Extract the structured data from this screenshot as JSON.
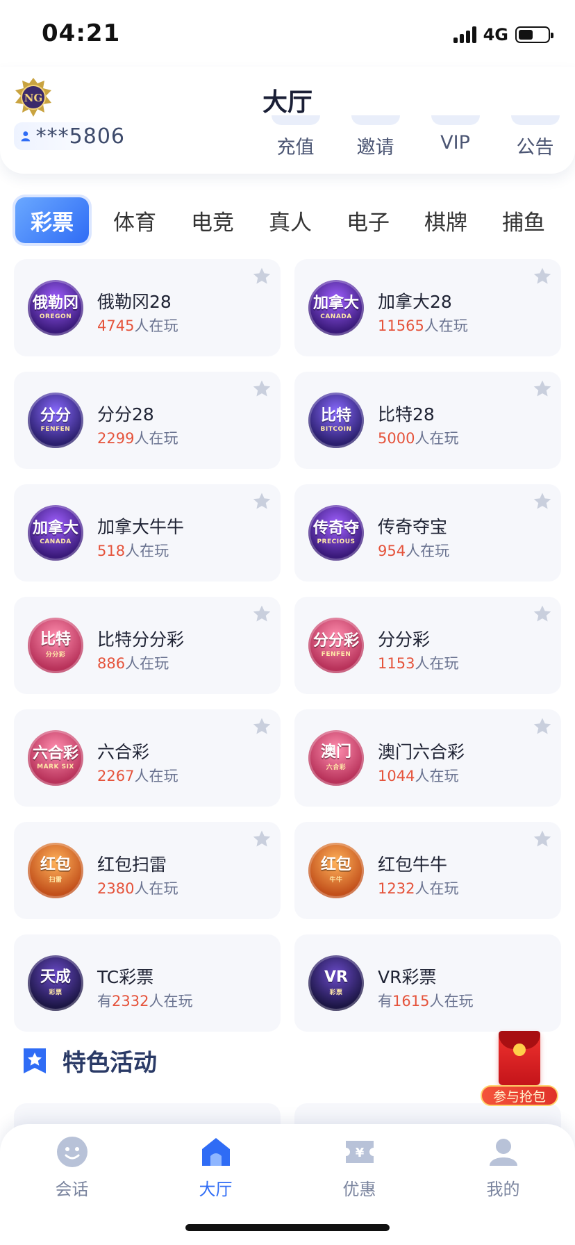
{
  "status": {
    "time": "04:21",
    "network": "4G"
  },
  "header": {
    "title": "大厅",
    "user_id": "***5806",
    "quick_menu": [
      "充值",
      "邀请",
      "VIP",
      "公告"
    ]
  },
  "tabs": [
    "彩票",
    "体育",
    "电竞",
    "真人",
    "电子",
    "棋牌",
    "捕鱼"
  ],
  "games": [
    {
      "name": "俄勒冈28",
      "prefix": "",
      "count": "4745",
      "suffix": "人在玩",
      "icon_text": "俄勒冈",
      "icon_sub": "OREGON"
    },
    {
      "name": "加拿大28",
      "prefix": "",
      "count": "11565",
      "suffix": "人在玩",
      "icon_text": "加拿大",
      "icon_sub": "CANADA"
    },
    {
      "name": "分分28",
      "prefix": "",
      "count": "2299",
      "suffix": "人在玩",
      "icon_text": "分分",
      "icon_sub": "FENFEN"
    },
    {
      "name": "比特28",
      "prefix": "",
      "count": "5000",
      "suffix": "人在玩",
      "icon_text": "比特",
      "icon_sub": "BITCOIN"
    },
    {
      "name": "加拿大牛牛",
      "prefix": "",
      "count": "518",
      "suffix": "人在玩",
      "icon_text": "加拿大",
      "icon_sub": "CANADA"
    },
    {
      "name": "传奇夺宝",
      "prefix": "",
      "count": "954",
      "suffix": "人在玩",
      "icon_text": "传奇夺",
      "icon_sub": "PRECIOUS"
    },
    {
      "name": "比特分分彩",
      "prefix": "",
      "count": "886",
      "suffix": "人在玩",
      "icon_text": "比特",
      "icon_sub": "分分彩"
    },
    {
      "name": "分分彩",
      "prefix": "",
      "count": "1153",
      "suffix": "人在玩",
      "icon_text": "分分彩",
      "icon_sub": "FENFEN"
    },
    {
      "name": "六合彩",
      "prefix": "",
      "count": "2267",
      "suffix": "人在玩",
      "icon_text": "六合彩",
      "icon_sub": "MARK SIX"
    },
    {
      "name": "澳门六合彩",
      "prefix": "",
      "count": "1044",
      "suffix": "人在玩",
      "icon_text": "澳门",
      "icon_sub": "六合彩"
    },
    {
      "name": "红包扫雷",
      "prefix": "",
      "count": "2380",
      "suffix": "人在玩",
      "icon_text": "红包",
      "icon_sub": "扫雷"
    },
    {
      "name": "红包牛牛",
      "prefix": "",
      "count": "1232",
      "suffix": "人在玩",
      "icon_text": "红包",
      "icon_sub": "牛牛"
    },
    {
      "name": "TC彩票",
      "prefix": "有",
      "count": "2332",
      "suffix": "人在玩",
      "icon_text": "天成",
      "icon_sub": "彩票"
    },
    {
      "name": "VR彩票",
      "prefix": "有",
      "count": "1615",
      "suffix": "人在玩",
      "icon_text": "VR",
      "icon_sub": "彩票"
    }
  ],
  "featured": {
    "title": "特色活动"
  },
  "red_packet": {
    "label": "参与抢包"
  },
  "bottom_nav": [
    "会话",
    "大厅",
    "优惠",
    "我的"
  ],
  "colors": {
    "accent": "#2f6cf5",
    "count": "#e5533b",
    "card_bg": "#f6f7fb"
  }
}
